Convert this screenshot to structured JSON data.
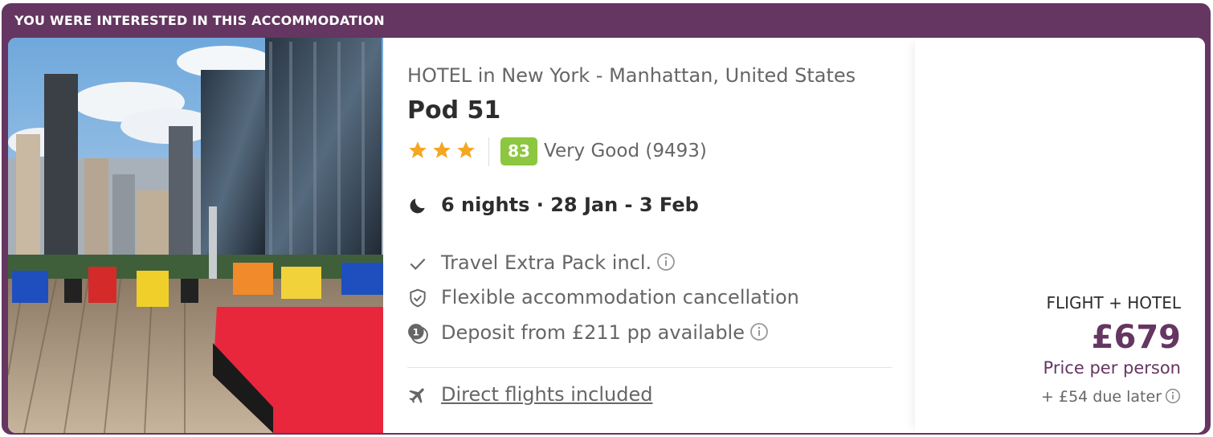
{
  "banner": {
    "label": "YOU WERE INTERESTED IN THIS ACCOMMODATION"
  },
  "hotel": {
    "location": "HOTEL in New York - Manhattan, United States",
    "name": "Pod 51",
    "stars": 3,
    "score": "83",
    "score_text": "Very Good (9493)"
  },
  "stay": {
    "summary": "6 nights · 28 Jan - 3 Feb"
  },
  "features": [
    {
      "icon": "check-icon",
      "text": "Travel Extra Pack incl."
    },
    {
      "icon": "shield-check-icon",
      "text": "Flexible accommodation cancellation"
    },
    {
      "icon": "deposit-coin-icon",
      "text": "Deposit from £211 pp available"
    }
  ],
  "flights": {
    "icon": "plane-icon",
    "label": "Direct flights included"
  },
  "price": {
    "label": "FLIGHT + HOTEL",
    "amount": "£679",
    "per": "Price per person",
    "later": "+ £54 due later"
  },
  "colors": {
    "brand": "#643661",
    "score": "#8dc63f",
    "star": "#f5a623",
    "text_dark": "#2d2d2d",
    "text_muted": "#666666"
  }
}
